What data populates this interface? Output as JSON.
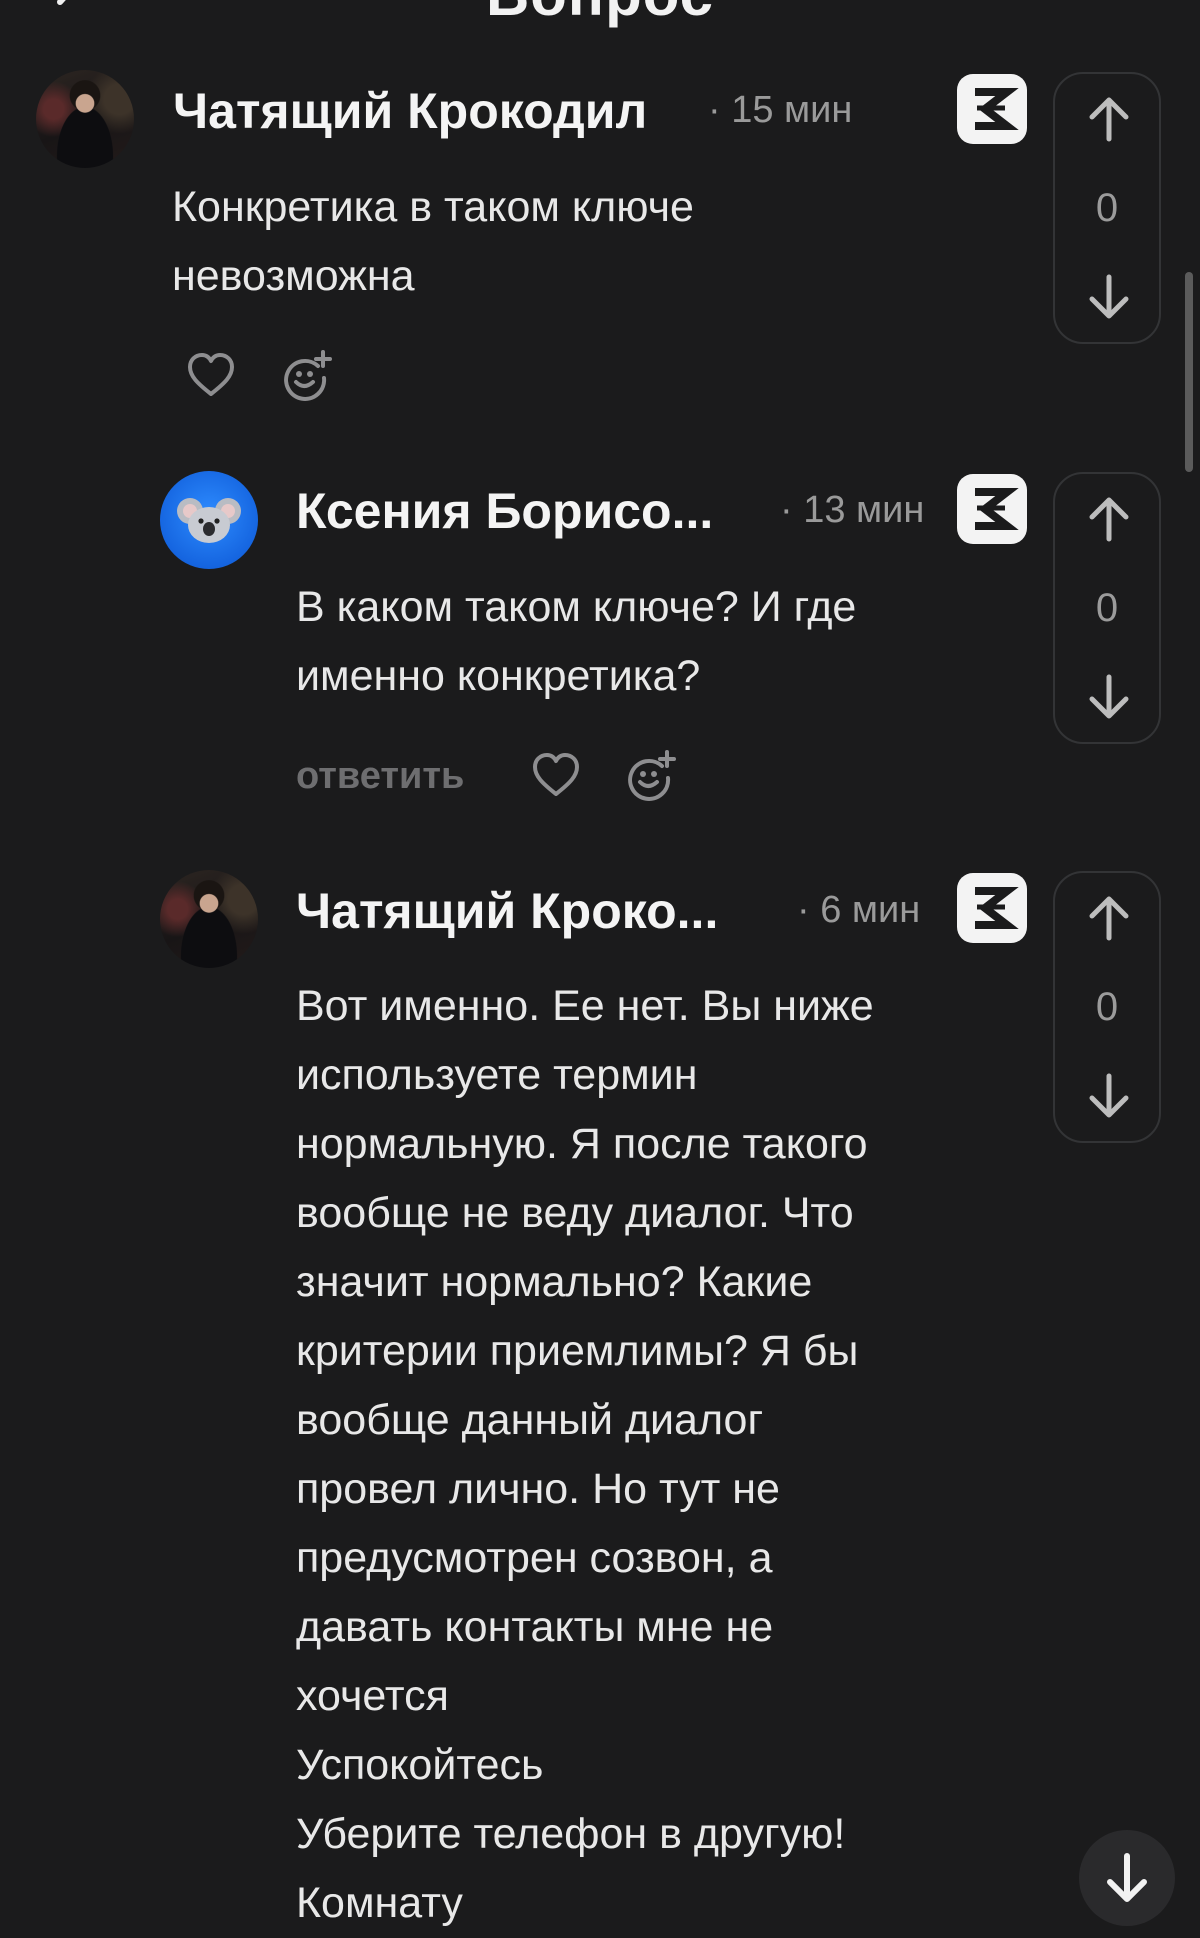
{
  "header": {
    "title": "Вопрос"
  },
  "comments": [
    {
      "author": "Чатящий Крокодил",
      "time": "· 15 мин",
      "text": "Конкретика в таком ключе\nневозможна",
      "votes": "0",
      "avatar_icon": "user-photo"
    },
    {
      "author": "Ксения Борисо...",
      "time": "· 13 мин",
      "text": "В каком таком ключе? И где\nименно конкретика?",
      "votes": "0",
      "reply_label": "ответить",
      "avatar_icon": "koala-emoji"
    },
    {
      "author": "Чатящий Кроко...",
      "time": "· 6 мин",
      "text": "Вот именно. Ее нет. Вы ниже\nиспользуете термин\nнормальную. Я после такого\nвообще не веду диалог. Что\nзначит нормально? Какие\nкритерии приемлимы? Я бы\nвообще данный диалог\nпровел лично. Но тут не\nпредусмотрен созвон, а\nдавать контакты мне не\nхочется\nУспокойтесь\nУберите телефон в другую!\nКомнату",
      "votes": "0",
      "avatar_icon": "user-photo"
    }
  ],
  "colors": {
    "background": "#1b1b1c",
    "text": "#e8e8e8",
    "muted": "#9a9a9a",
    "badge": "#f3f3f3",
    "koala_avatar": "#1565e0"
  }
}
